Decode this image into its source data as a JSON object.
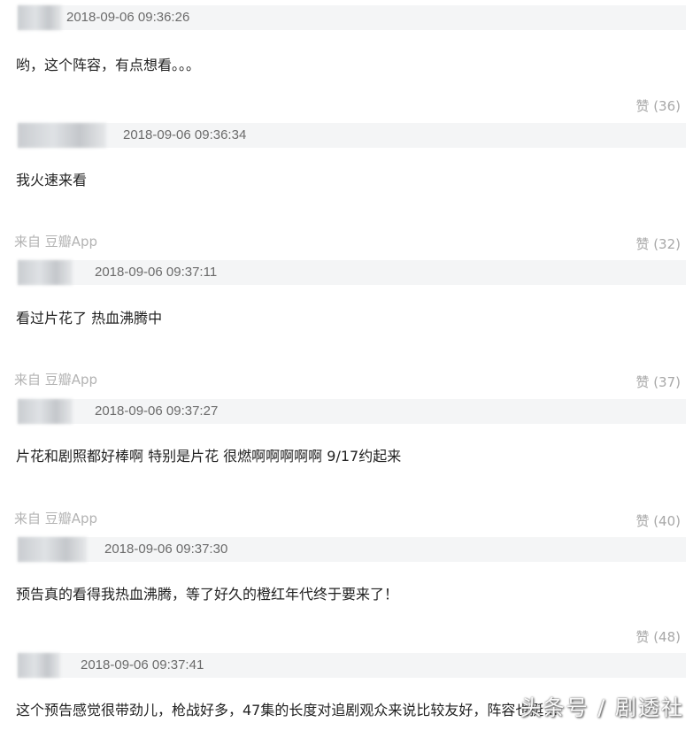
{
  "comments": [
    {
      "timestamp": "2018-09-06 09:36:26",
      "text": "哟，这个阵容，有点想看。。。",
      "source": "",
      "likes": "赞 (36)"
    },
    {
      "timestamp": "2018-09-06 09:36:34",
      "text": "我火速来看",
      "source": "来自 豆瓣App",
      "likes": "赞 (32)"
    },
    {
      "timestamp": "2018-09-06 09:37:11",
      "text": "看过片花了 热血沸腾中",
      "source": "来自 豆瓣App",
      "likes": "赞 (37)"
    },
    {
      "timestamp": "2018-09-06 09:37:27",
      "text": "片花和剧照都好棒啊 特别是片花 很燃啊啊啊啊啊 9/17约起来",
      "source": "来自 豆瓣App",
      "likes": "赞 (40)"
    },
    {
      "timestamp": "2018-09-06 09:37:30",
      "text": "预告真的看得我热血沸腾，等了好久的橙红年代终于要来了！",
      "source": "",
      "likes": "赞 (48)"
    },
    {
      "timestamp": "2018-09-06 09:37:41",
      "text": "这个预告感觉很带劲儿，枪战好多，47集的长度对追剧观众来说比较友好，阵容也挺…",
      "source": "",
      "likes": ""
    }
  ],
  "watermark": "头条号 / 剧透社"
}
